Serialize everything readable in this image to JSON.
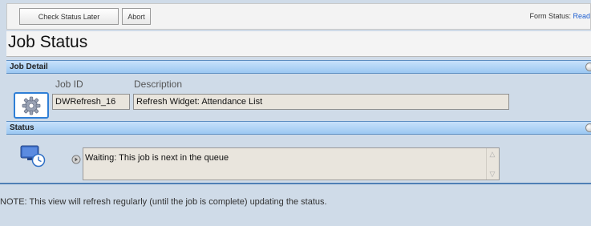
{
  "toolbar": {
    "check_status_later": "Check Status Later",
    "abort": "Abort",
    "form_status_label": "Form Status:",
    "form_status_value": "Read"
  },
  "page": {
    "title": "Job Status"
  },
  "job_detail": {
    "header": "Job Detail",
    "job_id_label": "Job ID",
    "description_label": "Description",
    "job_id_value": "DWRefresh_16",
    "description_value": "Refresh Widget: Attendance List",
    "icon": "gear-icon"
  },
  "status": {
    "header": "Status",
    "message": "Waiting: This job is next in the queue",
    "icon": "monitor-clock-icon"
  },
  "note": "NOTE: This view will refresh regularly (until the job is complete) updating the status.",
  "colors": {
    "background": "#cfdbe8",
    "section_header": "#9cc8f2",
    "accent_link": "#1f5fd1",
    "field_bg": "#e9e5dd"
  }
}
